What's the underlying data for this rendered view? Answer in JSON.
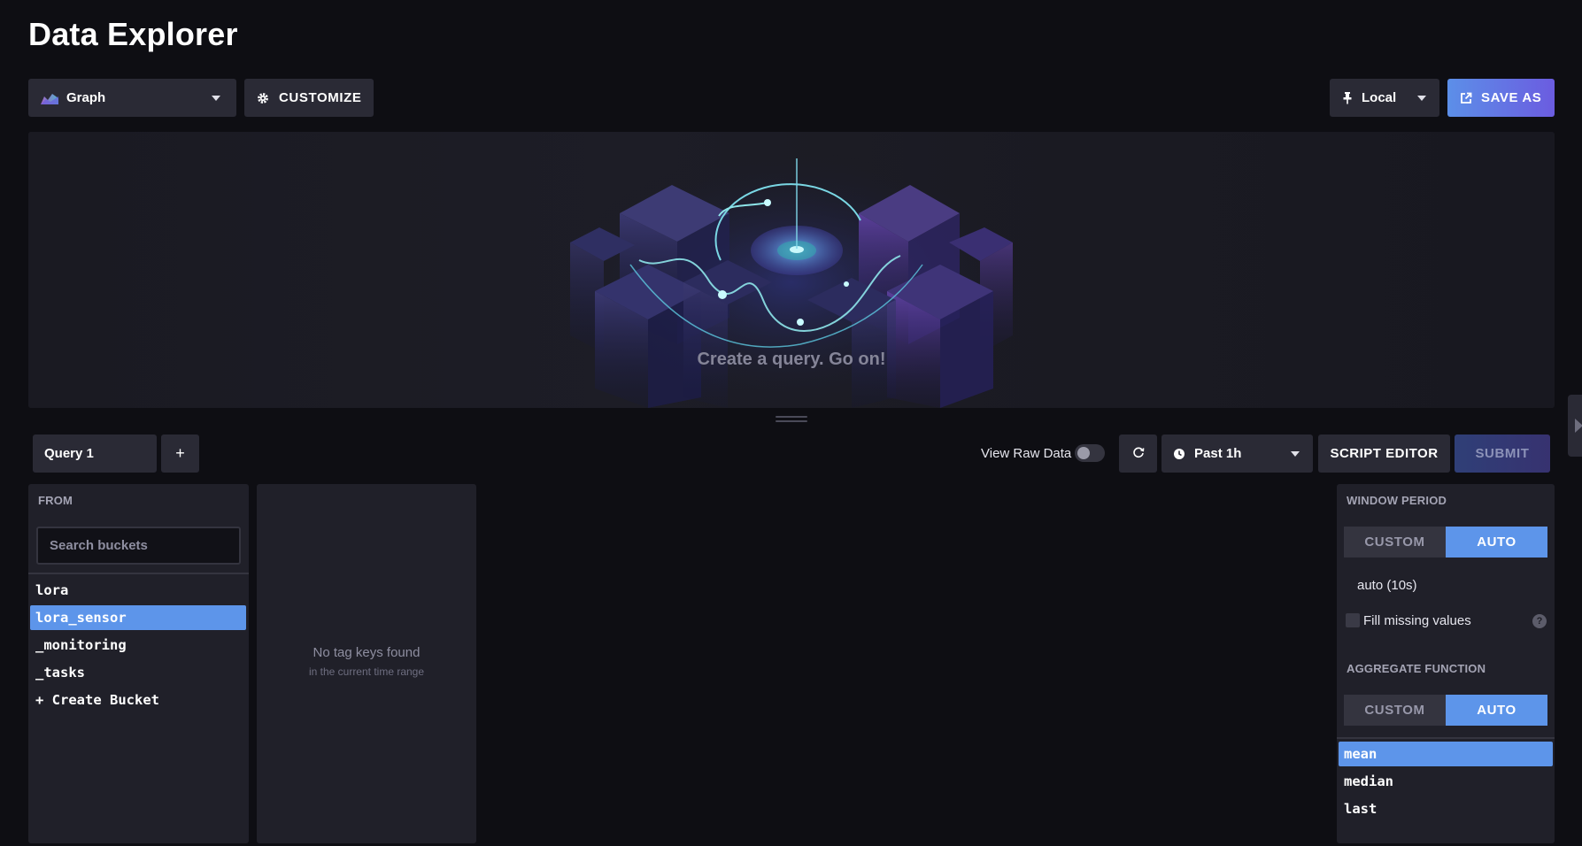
{
  "page": {
    "title": "Data Explorer"
  },
  "toolbar": {
    "vis_type": "Graph",
    "customize_label": "CUSTOMIZE",
    "timezone": "Local",
    "save_as_label": "SAVE AS"
  },
  "graph": {
    "empty_message": "Create a query. Go on!"
  },
  "query_bar": {
    "tab_label": "Query 1",
    "add_label": "+",
    "view_raw_label": "View Raw Data",
    "view_raw_on": false,
    "time_range": "Past 1h",
    "script_editor_label": "SCRIPT EDITOR",
    "submit_label": "SUBMIT"
  },
  "from": {
    "label": "FROM",
    "search_placeholder": "Search buckets",
    "buckets": [
      "lora",
      "lora_sensor",
      "_monitoring",
      "_tasks"
    ],
    "selected_bucket": "lora_sensor",
    "create_label": "+ Create Bucket"
  },
  "tags": {
    "empty_title": "No tag keys found",
    "empty_sub": "in the current time range"
  },
  "window": {
    "label": "WINDOW PERIOD",
    "custom_label": "CUSTOM",
    "auto_label": "AUTO",
    "value": "auto (10s)",
    "fill_label": "Fill missing values",
    "fill_checked": false
  },
  "aggregate": {
    "label": "AGGREGATE FUNCTION",
    "custom_label": "CUSTOM",
    "auto_label": "AUTO",
    "functions": [
      "mean",
      "median",
      "last"
    ],
    "selected": "mean"
  },
  "colors": {
    "accent": "#5d95ea",
    "background": "#0e0e13",
    "panel": "#202029",
    "button": "#2a2a35"
  }
}
